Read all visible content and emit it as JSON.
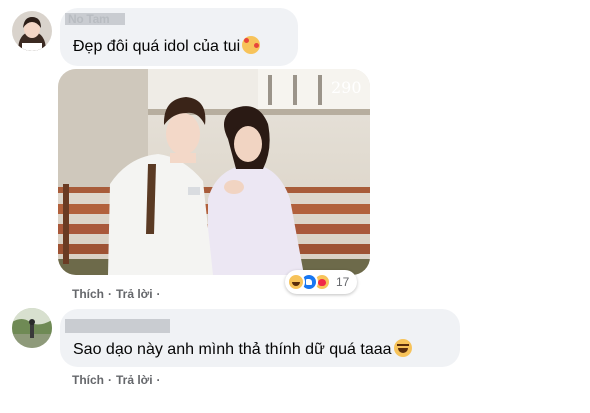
{
  "comments": [
    {
      "author_hint": "No Tam",
      "text": "Đẹp đôi quá idol của tui",
      "emoji": "smiling-face-with-hearts",
      "reactions": {
        "count": "17",
        "types": [
          "haha",
          "like",
          "care"
        ]
      },
      "actions": {
        "like": "Thích",
        "reply": "Trả lời",
        "separator": "·"
      },
      "photo_watermark": "290"
    },
    {
      "text": "Sao dạo này anh mình thả thính dữ quá taaa",
      "emoji": "grinning-squinting-face",
      "actions": {
        "like": "Thích",
        "reply": "Trả lời",
        "separator": "·"
      }
    }
  ],
  "colors": {
    "bubble": "#f0f2f5",
    "action_text": "#65676b",
    "comment_text": "#050505",
    "like_blue": "#1877f2"
  }
}
